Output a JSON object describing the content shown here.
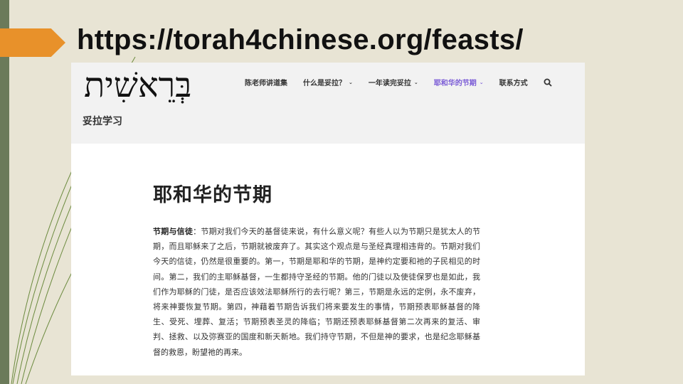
{
  "slide": {
    "title": "https://torah4chinese.org/feasts/",
    "colors": {
      "accent": "#e8912a",
      "sidebar": "#6b7a5a",
      "background": "#e8e4d4"
    }
  },
  "site": {
    "logo_text": "בְּרֵאשִׁית",
    "name": "妥拉学习",
    "nav": [
      {
        "label": "陈老师讲道集",
        "has_dropdown": false,
        "active": false
      },
      {
        "label": "什么是妥拉？",
        "has_dropdown": true,
        "active": false
      },
      {
        "label": "一年读完妥拉",
        "has_dropdown": true,
        "active": false
      },
      {
        "label": "耶和华的节期",
        "has_dropdown": true,
        "active": true
      },
      {
        "label": "联系方式",
        "has_dropdown": false,
        "active": false
      }
    ],
    "nav_chevron": "⌄",
    "search_icon": "search-icon",
    "active_color": "#7a5bd6"
  },
  "page": {
    "title": "耶和华的节期",
    "lead": "节期与信徒",
    "body": "：节期对我们今天的基督徒来说，有什么意义呢？有些人以为节期只是犹太人的节期，而且耶稣来了之后，节期就被废弃了。其实这个观点是与圣经真理相违背的。节期对我们今天的信徒，仍然是很重要的。第一，节期是耶和华的节期，是神约定要和祂的子民相见的时间。第二，我们的主耶稣基督，一生都持守圣经的节期。他的门徒以及使徒保罗也是如此，我们作为耶稣的门徒，是否应该效法耶稣所行的去行呢？第三，节期是永远的定例，永不废弃，将来神要恢复节期。第四，神藉着节期告诉我们将来要发生的事情，节期预表耶稣基督的降生、受死、埋葬、复活；节期预表圣灵的降临；节期还预表耶稣基督第二次再来的复活、审判、拯救、以及弥赛亚的国度和新天新地。我们持守节期，不但是神的要求，也是纪念耶稣基督的救恩，盼望祂的再来。"
  }
}
